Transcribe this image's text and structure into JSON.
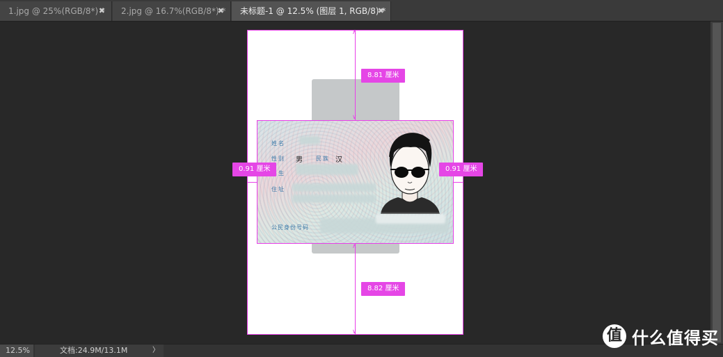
{
  "tabs": [
    {
      "label": "1.jpg @ 25%(RGB/8*) *",
      "close": "✖"
    },
    {
      "label": "2.jpg @ 16.7%(RGB/8*) *",
      "close": "✖"
    },
    {
      "label": "未标题-1 @ 12.5% (图层 1, RGB/8) *",
      "close": "✖"
    }
  ],
  "measurements": {
    "top": "8.81 厘米",
    "left": "0.91 厘米",
    "right": "0.91 厘米",
    "bottom": "8.82 厘米"
  },
  "id_card": {
    "name_label": "姓名",
    "gender_label": "性别",
    "gender_value": "男",
    "ethnicity_label": "民族",
    "ethnicity_value": "汉",
    "birth_label": "出生",
    "address_label": "住址",
    "id_number_label": "公民身份号码"
  },
  "status": {
    "zoom": "12.5%",
    "doc_info": "文档:24.9M/13.1M",
    "menu_arrow": "〉"
  },
  "watermark": {
    "logo": "值",
    "text": "什么值得买"
  },
  "colors": {
    "guide": "#e83ee8",
    "badge": "#e546e6",
    "canvas_bg": "#282828"
  }
}
